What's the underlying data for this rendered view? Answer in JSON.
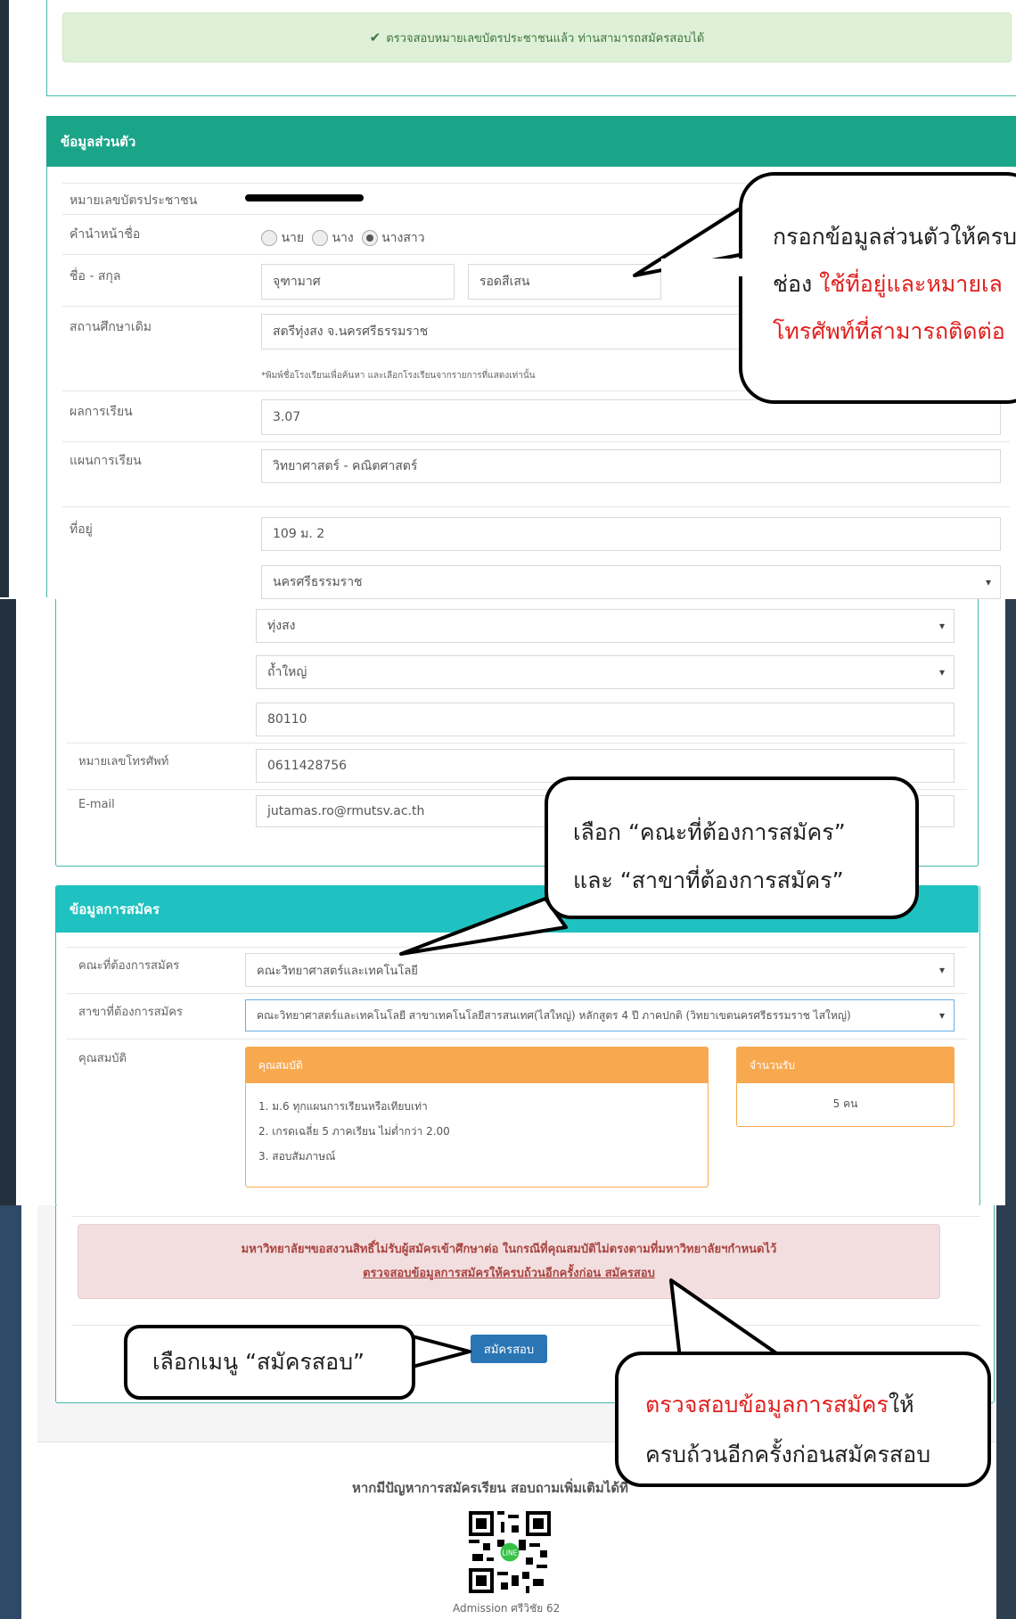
{
  "verify": {
    "message": "ตรวจสอบหมายเลขบัตรประชาชนแล้ว ท่านสามารถสมัครสอบได้"
  },
  "personal": {
    "title": "ข้อมูลส่วนตัว",
    "id_label": "หมายเลขบัตรประชาชน",
    "prefix_label": "คำนำหน้าชื่อ",
    "prefix_options": [
      "นาย",
      "นาง",
      "นางสาว"
    ],
    "name_label": "ชื่อ - สกุล",
    "first_name": "จุฑามาศ",
    "last_name": "รอดสีเสน",
    "school_label": "สถานศึกษาเดิม",
    "school_value": "สตรีทุ่งสง จ.นครศรีธรรมราช",
    "school_hint": "*พิมพ์ชื่อโรงเรียนเพื่อค้นหา และเลือกโรงเรียนจากรายการที่แสดงเท่านั้น",
    "gpa_label": "ผลการเรียน",
    "gpa_value": "3.07",
    "plan_label": "แผนการเรียน",
    "plan_value": "วิทยาศาสตร์ - คณิตศาสตร์",
    "address_label": "ที่อยู่",
    "address_value": "109 ม. 2",
    "province": "นครศรีธรรมราช",
    "district": "ทุ่งสง",
    "subdistrict": "ถ้ำใหญ่",
    "postcode": "80110",
    "phone_label": "หมายเลขโทรศัพท์",
    "phone_value": "0611428756",
    "email_label": "E-mail",
    "email_value": "jutamas.ro@rmutsv.ac.th"
  },
  "apply": {
    "title": "ข้อมูลการสมัคร",
    "faculty_label": "คณะที่ต้องการสมัคร",
    "faculty_value": "คณะวิทยาศาสตร์และเทคโนโลยี",
    "major_label": "สาขาที่ต้องการสมัคร",
    "major_value": "คณะวิทยาศาสตร์และเทคโนโลยี สาขาเทคโนโลยีสารสนเทศ(ไสใหญ่) หลักสูตร 4 ปี ภาคปกติ (วิทยาเขตนครศรีธรรมราช ไสใหญ่)",
    "qual_label": "คุณสมบัติ",
    "qual_box_title": "คุณสมบัติ",
    "qual_items": [
      "1. ม.6 ทุกแผนการเรียนหรือเทียบเท่า",
      "2. เกรดเฉลี่ย 5 ภาคเรียน ไม่ต่ำกว่า 2.00",
      "3. สอบสัมภาษณ์"
    ],
    "seats_title": "จำนวนรับ",
    "seats_value": "5 คน",
    "warning_line1": "มหาวิทยาลัยฯขอสงวนสิทธิ์ไม่รับผู้สมัครเข้าศึกษาต่อ ในกรณีที่คุณสมบัติไม่ตรงตามที่มหาวิทยาลัยฯกำหนดไว้",
    "warning_line2": "ตรวจสอบข้อมูลการสมัครให้ครบถ้วนอีกครั้งก่อน สมัครสอบ",
    "submit_label": "สมัครสอบ"
  },
  "footer": {
    "help_text": "หากมีปัญหาการสมัครเรียน สอบถามเพิ่มเติมได้ที่",
    "qr_caption": "Admission ศรีวิชัย 62"
  },
  "callouts": {
    "c1_line1": "กรอกข้อมูลส่วนตัวให้ครบ",
    "c1_line2a": "ช่อง ",
    "c1_line2b": "ใช้ที่อยู่และหมายเล",
    "c1_line3": "โทรศัพท์ที่สามารถติดต่อ",
    "c2_line1": "เลือก “คณะที่ต้องการสมัคร”",
    "c2_line2": "และ “สาขาที่ต้องการสมัคร”",
    "c3_text": "เลือกเมนู “สมัครสอบ”",
    "c4_line1a": "ตรวจสอบข้อมูลการสมัคร",
    "c4_line1b": "ให้",
    "c4_line2": "ครบถ้วนอีกครั้งก่อนสมัครสอบ"
  },
  "colors": {
    "teal": "#1aa589",
    "cyan": "#1fc2c0",
    "orange": "#f8a950",
    "success_bg": "#dff0d8",
    "danger_bg": "#f2dede",
    "primary": "#2a76b5"
  }
}
